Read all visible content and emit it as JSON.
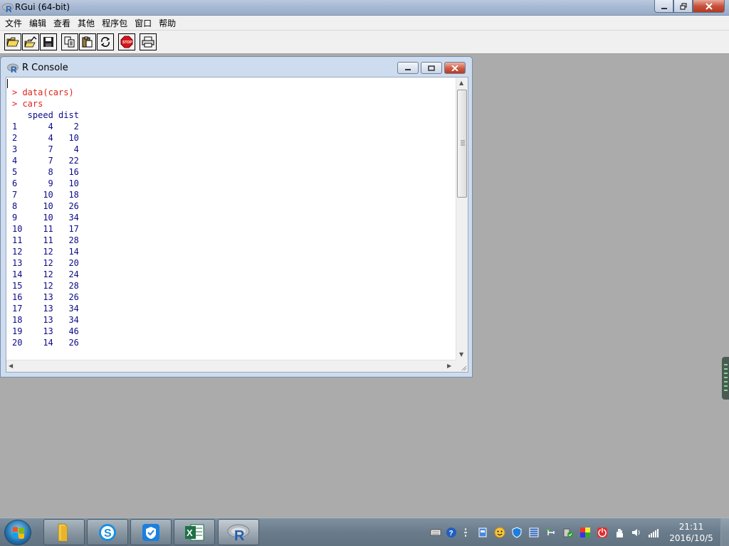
{
  "app": {
    "title": "RGui (64-bit)"
  },
  "menu": [
    "文件",
    "编辑",
    "查看",
    "其他",
    "程序包",
    "窗口",
    "帮助"
  ],
  "toolbar": {
    "buttons": [
      "open-script",
      "load-workspace",
      "save-workspace",
      "copy",
      "paste",
      "copy-paste",
      "stop",
      "print"
    ]
  },
  "console": {
    "title": "R Console",
    "commands": [
      "> data(cars)",
      "> cars"
    ],
    "header": "   speed dist",
    "rows": [
      {
        "id": "1",
        "speed": "4",
        "dist": "2"
      },
      {
        "id": "2",
        "speed": "4",
        "dist": "10"
      },
      {
        "id": "3",
        "speed": "7",
        "dist": "4"
      },
      {
        "id": "4",
        "speed": "7",
        "dist": "22"
      },
      {
        "id": "5",
        "speed": "8",
        "dist": "16"
      },
      {
        "id": "6",
        "speed": "9",
        "dist": "10"
      },
      {
        "id": "7",
        "speed": "10",
        "dist": "18"
      },
      {
        "id": "8",
        "speed": "10",
        "dist": "26"
      },
      {
        "id": "9",
        "speed": "10",
        "dist": "34"
      },
      {
        "id": "10",
        "speed": "11",
        "dist": "17"
      },
      {
        "id": "11",
        "speed": "11",
        "dist": "28"
      },
      {
        "id": "12",
        "speed": "12",
        "dist": "14"
      },
      {
        "id": "13",
        "speed": "12",
        "dist": "20"
      },
      {
        "id": "14",
        "speed": "12",
        "dist": "24"
      },
      {
        "id": "15",
        "speed": "12",
        "dist": "28"
      },
      {
        "id": "16",
        "speed": "13",
        "dist": "26"
      },
      {
        "id": "17",
        "speed": "13",
        "dist": "34"
      },
      {
        "id": "18",
        "speed": "13",
        "dist": "34"
      },
      {
        "id": "19",
        "speed": "13",
        "dist": "46"
      },
      {
        "id": "20",
        "speed": "14",
        "dist": "26"
      }
    ]
  },
  "taskbar": {
    "apps": [
      "file-explorer",
      "sogou-browser",
      "security-guard",
      "excel",
      "r-gui"
    ],
    "clock": {
      "time": "21:11",
      "date": "2016/10/5"
    }
  },
  "colors": {
    "command": "#e0241a",
    "output": "#0b0b8a",
    "desktop": "#ababab"
  }
}
